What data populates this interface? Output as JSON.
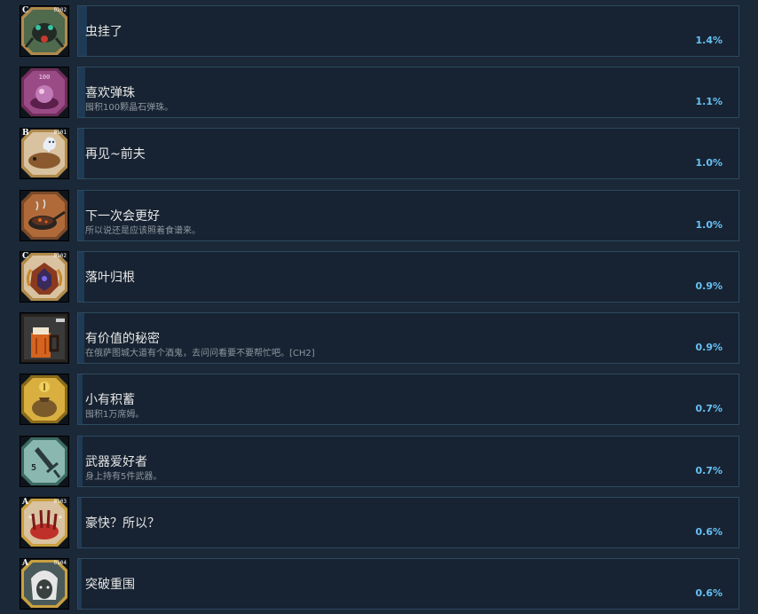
{
  "achievements": [
    {
      "name": "虫挂了",
      "desc": "",
      "pct": "1.4%",
      "pct_value": 1.4,
      "tag": "C",
      "code": "0202",
      "theme": "bug-mech"
    },
    {
      "name": "喜欢弹珠",
      "desc": "囤积100颗晶石弹珠。",
      "pct": "1.1%",
      "pct_value": 1.1,
      "tag": "",
      "code": "",
      "theme": "marbles",
      "badge": "100"
    },
    {
      "name": "再见~前夫",
      "desc": "",
      "pct": "1.0%",
      "pct_value": 1.0,
      "tag": "B",
      "code": "0101",
      "theme": "ghost-creature"
    },
    {
      "name": "下一次会更好",
      "desc": "所以说还是应该照着食谱来。",
      "pct": "1.0%",
      "pct_value": 1.0,
      "tag": "",
      "code": "",
      "theme": "burnt-pan"
    },
    {
      "name": "落叶归根",
      "desc": "",
      "pct": "0.9%",
      "pct_value": 0.9,
      "tag": "C",
      "code": "0102",
      "theme": "leaf-creature"
    },
    {
      "name": "有价值的秘密",
      "desc": "在俄萨图城大道有个酒鬼，去问问看要不要帮忙吧。[CH2]",
      "pct": "0.9%",
      "pct_value": 0.9,
      "tag": "",
      "code": "",
      "theme": "beer-mug"
    },
    {
      "name": "小有积蓄",
      "desc": "囤积1万席姆。",
      "pct": "0.7%",
      "pct_value": 0.7,
      "tag": "",
      "code": "",
      "theme": "money-bag"
    },
    {
      "name": "武器爱好者",
      "desc": "身上持有5件武器。",
      "pct": "0.7%",
      "pct_value": 0.7,
      "tag": "",
      "code": "",
      "theme": "sword",
      "badge": "5"
    },
    {
      "name": "豪快？所以？",
      "desc": "",
      "pct": "0.6%",
      "pct_value": 0.6,
      "tag": "A",
      "code": "0103",
      "theme": "red-claw"
    },
    {
      "name": "突破重围",
      "desc": "",
      "pct": "0.6%",
      "pct_value": 0.6,
      "tag": "A",
      "code": "0104",
      "theme": "white-hair"
    }
  ],
  "colors": {
    "background": "#1b2838",
    "card": "#172332",
    "border": "#2c4a5e",
    "percent": "#67c1f5",
    "progress": "#1f3a55"
  }
}
